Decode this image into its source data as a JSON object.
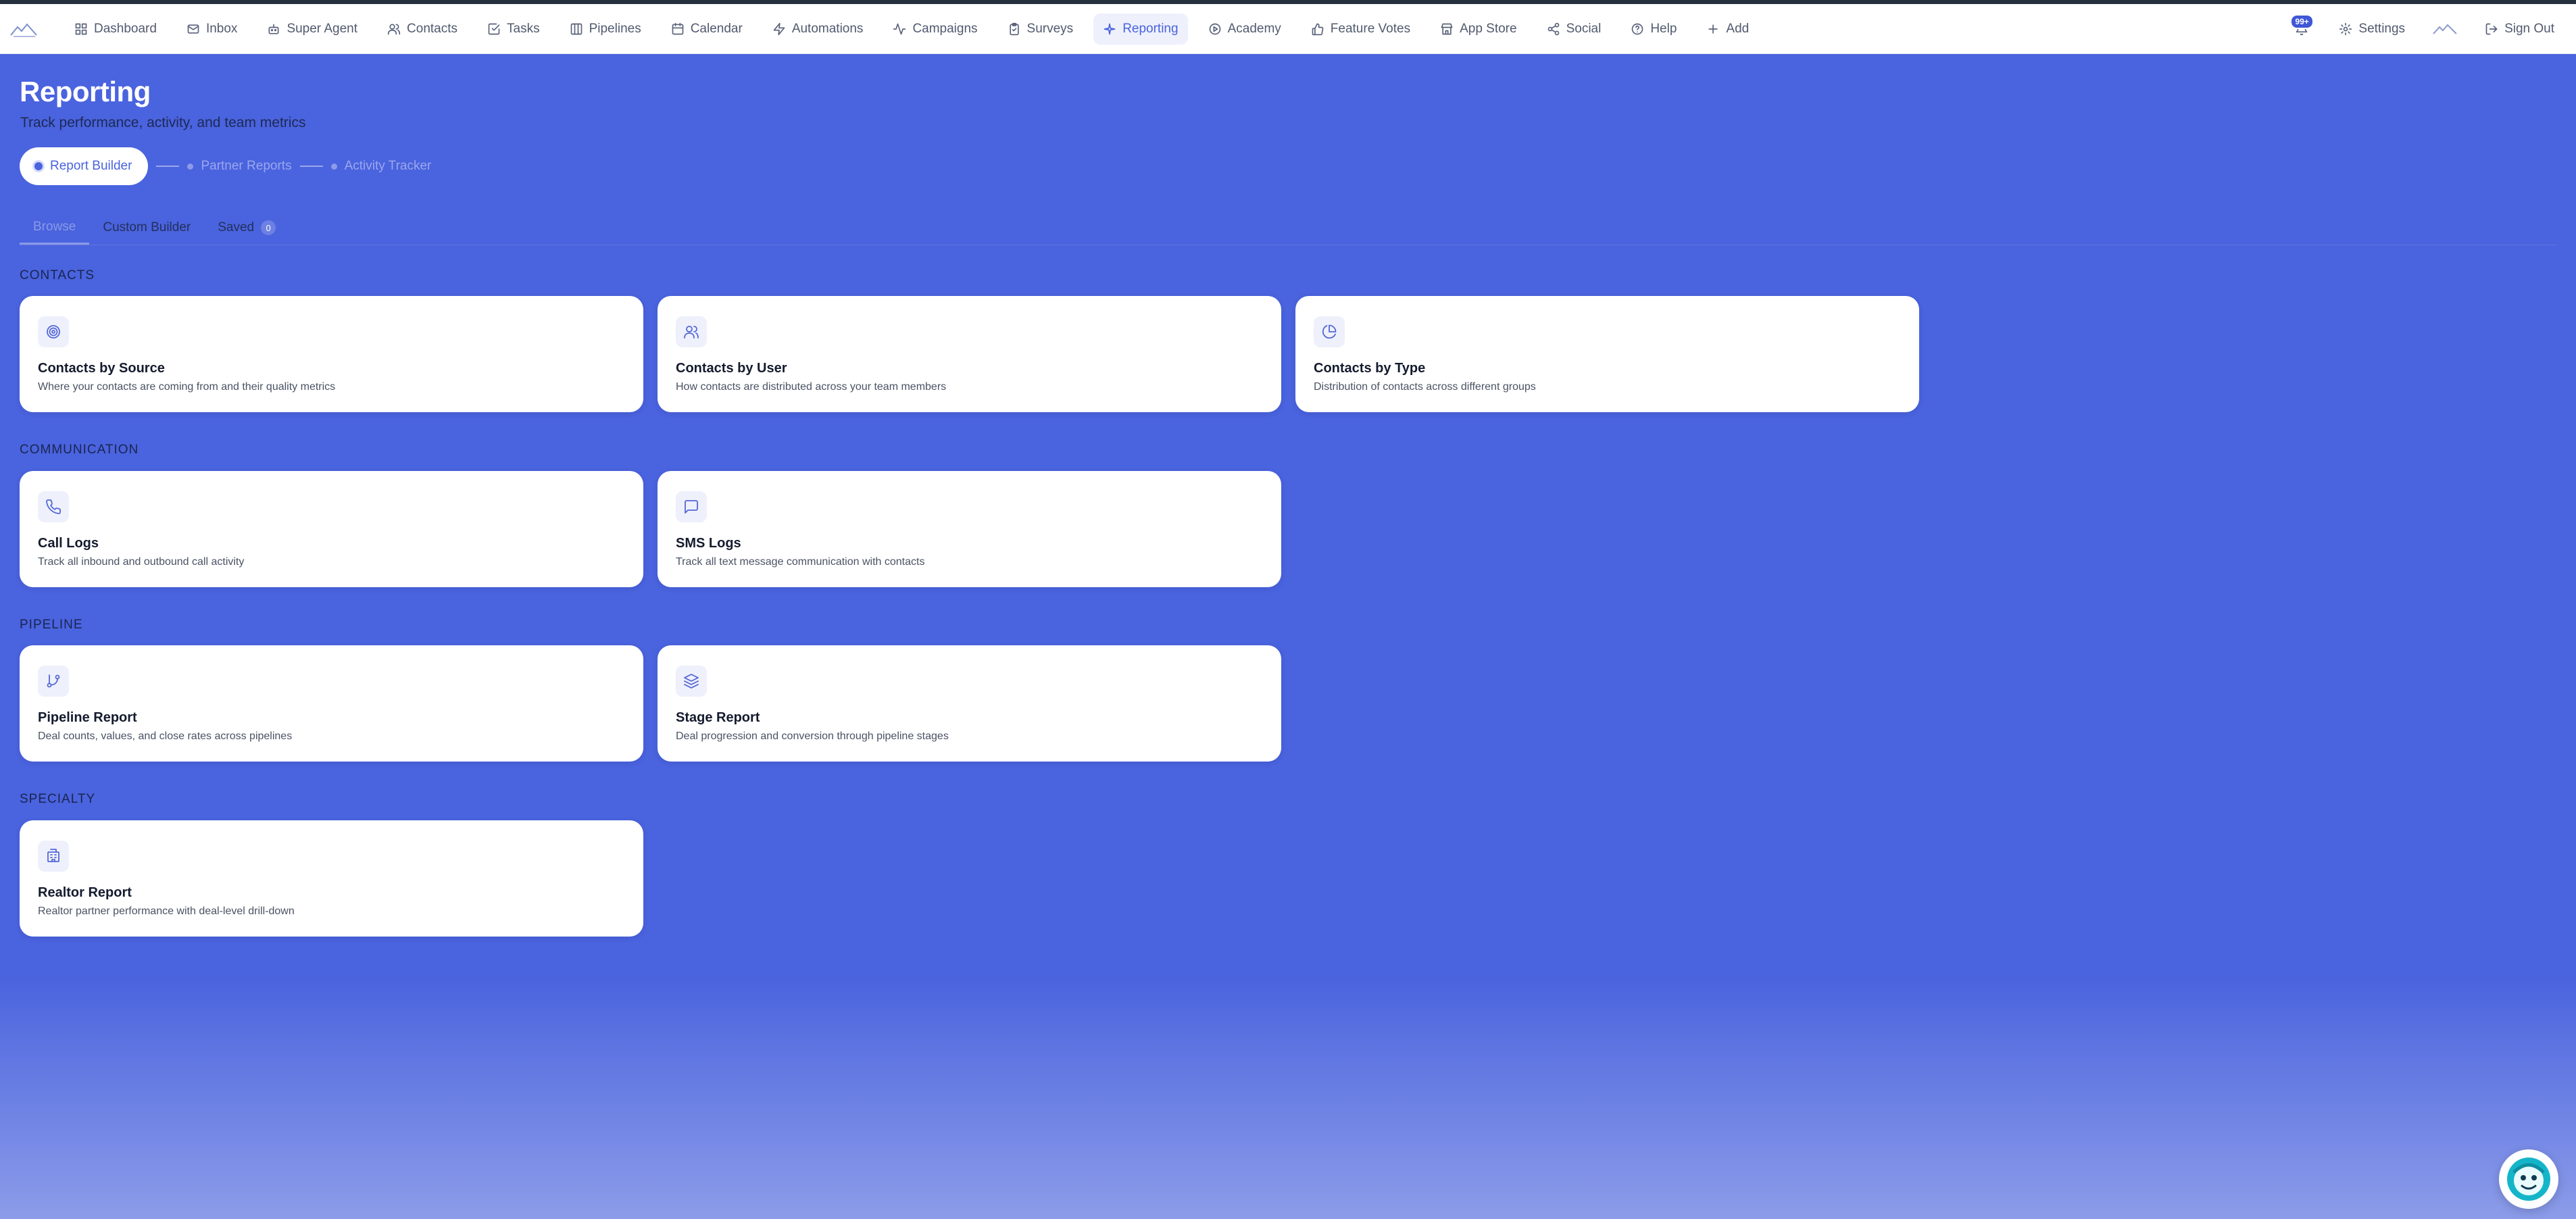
{
  "nav": {
    "items": [
      {
        "label": "Dashboard",
        "icon": "grid-icon"
      },
      {
        "label": "Inbox",
        "icon": "mail-icon"
      },
      {
        "label": "Super Agent",
        "icon": "bot-icon"
      },
      {
        "label": "Contacts",
        "icon": "users-icon"
      },
      {
        "label": "Tasks",
        "icon": "check-square-icon"
      },
      {
        "label": "Pipelines",
        "icon": "columns-icon"
      },
      {
        "label": "Calendar",
        "icon": "calendar-icon"
      },
      {
        "label": "Automations",
        "icon": "zap-icon"
      },
      {
        "label": "Campaigns",
        "icon": "activity-icon"
      },
      {
        "label": "Surveys",
        "icon": "clipboard-icon"
      },
      {
        "label": "Reporting",
        "icon": "sparkle-icon",
        "active": true
      },
      {
        "label": "Academy",
        "icon": "play-circle-icon"
      },
      {
        "label": "Feature Votes",
        "icon": "thumbs-up-icon"
      },
      {
        "label": "App Store",
        "icon": "store-icon"
      },
      {
        "label": "Social",
        "icon": "share-icon"
      },
      {
        "label": "Help",
        "icon": "help-circle-icon"
      },
      {
        "label": "Add",
        "icon": "plus-icon"
      }
    ],
    "notifications_badge": "99+",
    "settings_label": "Settings",
    "signout_label": "Sign Out"
  },
  "page": {
    "title": "Reporting",
    "subtitle": "Track performance, activity, and team metrics"
  },
  "stepper": {
    "steps": [
      "Report Builder",
      "Partner Reports",
      "Activity Tracker"
    ],
    "active": 0
  },
  "tabs": {
    "items": [
      "Browse",
      "Custom Builder",
      "Saved"
    ],
    "saved_count": "0",
    "active": 0
  },
  "sections": [
    {
      "label": "CONTACTS",
      "cards": [
        {
          "title": "Contacts by Source",
          "desc": "Where your contacts are coming from and their quality metrics",
          "icon": "target-icon"
        },
        {
          "title": "Contacts by User",
          "desc": "How contacts are distributed across your team members",
          "icon": "users-icon"
        },
        {
          "title": "Contacts by Type",
          "desc": "Distribution of contacts across different groups",
          "icon": "pie-chart-icon"
        }
      ]
    },
    {
      "label": "COMMUNICATION",
      "cards": [
        {
          "title": "Call Logs",
          "desc": "Track all inbound and outbound call activity",
          "icon": "phone-icon"
        },
        {
          "title": "SMS Logs",
          "desc": "Track all text message communication with contacts",
          "icon": "message-square-icon"
        }
      ]
    },
    {
      "label": "PIPELINE",
      "cards": [
        {
          "title": "Pipeline Report",
          "desc": "Deal counts, values, and close rates across pipelines",
          "icon": "git-branch-icon"
        },
        {
          "title": "Stage Report",
          "desc": "Deal progression and conversion through pipeline stages",
          "icon": "layers-icon"
        }
      ]
    },
    {
      "label": "SPECIALTY",
      "cards": [
        {
          "title": "Realtor Report",
          "desc": "Realtor partner performance with deal-level drill-down",
          "icon": "building-icon"
        }
      ]
    }
  ],
  "colors": {
    "background": "#4a63de",
    "accent": "#4a63de",
    "card": "#ffffff",
    "badge": "#3f56d6"
  }
}
